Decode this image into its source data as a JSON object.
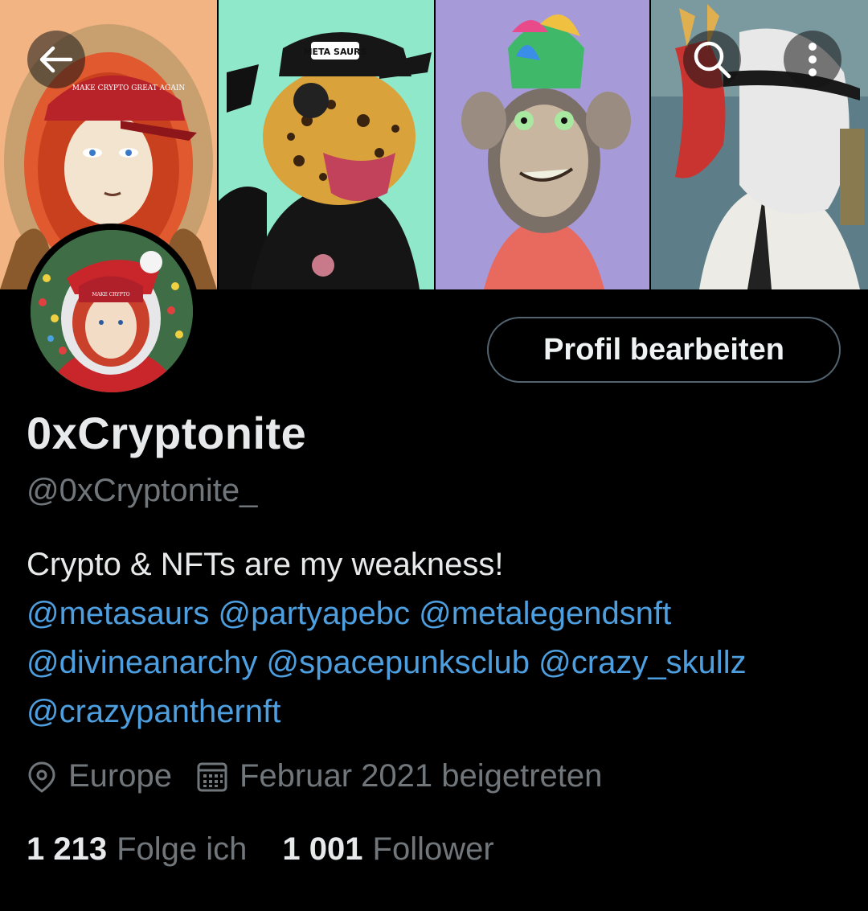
{
  "header": {
    "back_icon": "arrow-left-icon",
    "search_icon": "search-icon",
    "more_icon": "more-vertical-icon"
  },
  "banner": {
    "tile1_cap_text": "MAKE CRYPTO GREAT AGAIN",
    "tile2_cap_text": "META SAURS"
  },
  "profile": {
    "display_name": "0xCryptonite",
    "handle": "@0xCryptonite_",
    "edit_button_label": "Profil bearbeiten",
    "bio_text": "Crypto & NFTs are my weakness!",
    "mentions": [
      "@metasaurs",
      "@partyapebc",
      "@metalegendsnft",
      "@divineanarchy",
      "@spacepunksclub",
      "@crazy_skullz",
      "@crazypanthernft"
    ],
    "location": "Europe",
    "location_icon": "location-pin-icon",
    "joined": "Februar 2021 beigetreten",
    "joined_icon": "calendar-icon",
    "following_count": "1 213",
    "following_label": "Folge ich",
    "followers_count": "1 001",
    "followers_label": "Follower"
  },
  "colors": {
    "background": "#000000",
    "text": "#e7e9ea",
    "secondary_text": "#71767b",
    "link": "#4d9fe0",
    "button_border": "#536471"
  }
}
